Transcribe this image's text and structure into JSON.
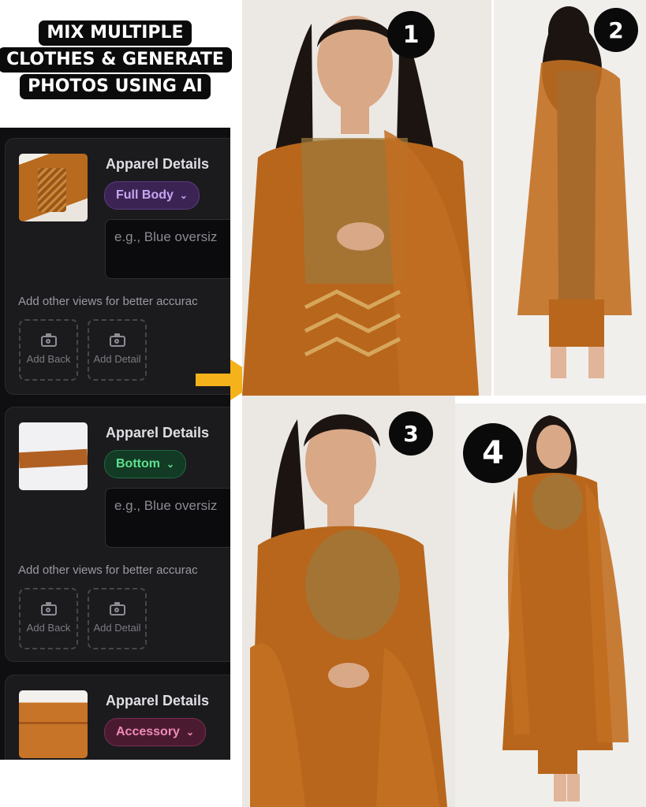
{
  "headline": {
    "lines": [
      "MIX MULTIPLE",
      "CLOTHES & GENERATE",
      "PHOTOS USING AI"
    ]
  },
  "panel": {
    "cards": [
      {
        "title": "Apparel Details",
        "category": "Full Body",
        "category_color": "#c8a4f2",
        "description_placeholder": "e.g., Blue oversiz",
        "hint": "Add other views for better accurac",
        "add_back_label": "Add Back",
        "add_detail_label": "Add Detail"
      },
      {
        "title": "Apparel Details",
        "category": "Bottom",
        "category_color": "#5fe08f",
        "description_placeholder": "e.g., Blue oversiz",
        "hint": "Add other views for better accurac",
        "add_back_label": "Add Back",
        "add_detail_label": "Add Detail"
      },
      {
        "title": "Apparel Details",
        "category": "Accessory",
        "category_color": "#f08ab8"
      }
    ]
  },
  "arrow_color": "#f5b21a",
  "results": [
    {
      "badge": "1"
    },
    {
      "badge": "2"
    },
    {
      "badge": "3"
    },
    {
      "badge": "4"
    }
  ],
  "outfit_color": "#b8661c"
}
